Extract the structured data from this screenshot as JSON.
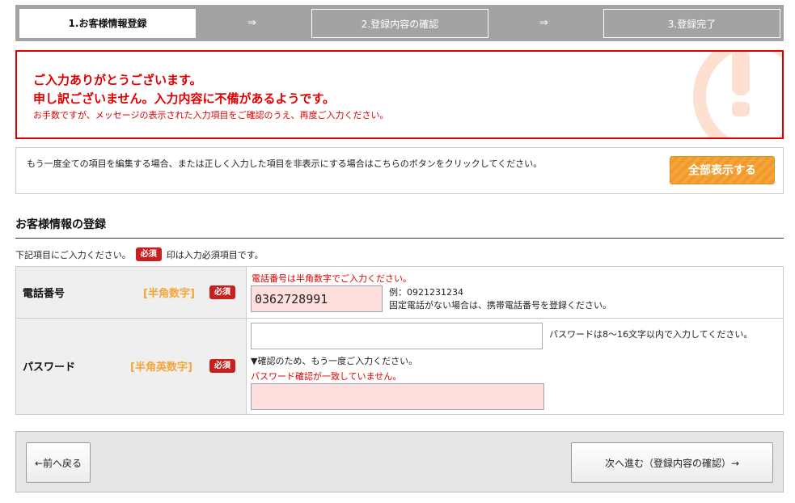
{
  "steps": {
    "step1": "1.お客様情報登録",
    "step2": "2.登録内容の確認",
    "step3": "3.登録完了",
    "arrow": "⇒"
  },
  "error": {
    "line1": "ご入力ありがとうございます。",
    "line2": "申し訳ございません。入力内容に不備があるようです。",
    "line3": "お手数ですが、メッセージの表示された入力項目をご確認のうえ、再度ご入力ください。"
  },
  "notice": {
    "text": "もう一度全ての項目を編集する場合、または正しく入力した項目を非表示にする場合はこちらのボタンをクリックしてください。",
    "button": "全部表示する"
  },
  "section": {
    "title": "お客様情報の登録",
    "intro_before": "下記項目にご入力ください。",
    "required_badge": "必須",
    "intro_after": "印は入力必須項目です。"
  },
  "phone": {
    "label": "電話番号",
    "hint": "[半角数字]",
    "badge": "必須",
    "error": "電話番号は半角数字でご入力ください。",
    "value": "0362728991",
    "example": "例：0921231234",
    "note": "固定電話がない場合は、携帯電話番号を登録ください。"
  },
  "password": {
    "label": "パスワード",
    "hint": "[半角英数字]",
    "badge": "必須",
    "value": "",
    "note": "パスワードは8〜16文字以内で入力してください。",
    "confirm_label": "▼確認のため、もう一度ご入力ください。",
    "confirm_error": "パスワード確認が一致していません。",
    "confirm_value": ""
  },
  "nav": {
    "back": "←前へ戻る",
    "next": "次へ進む（登録内容の確認）→"
  },
  "colors": {
    "error_red": "#e00000",
    "badge_red": "#c8201e",
    "accent_orange": "#f5a53a",
    "step_bar_gray": "#a3a3a3"
  }
}
